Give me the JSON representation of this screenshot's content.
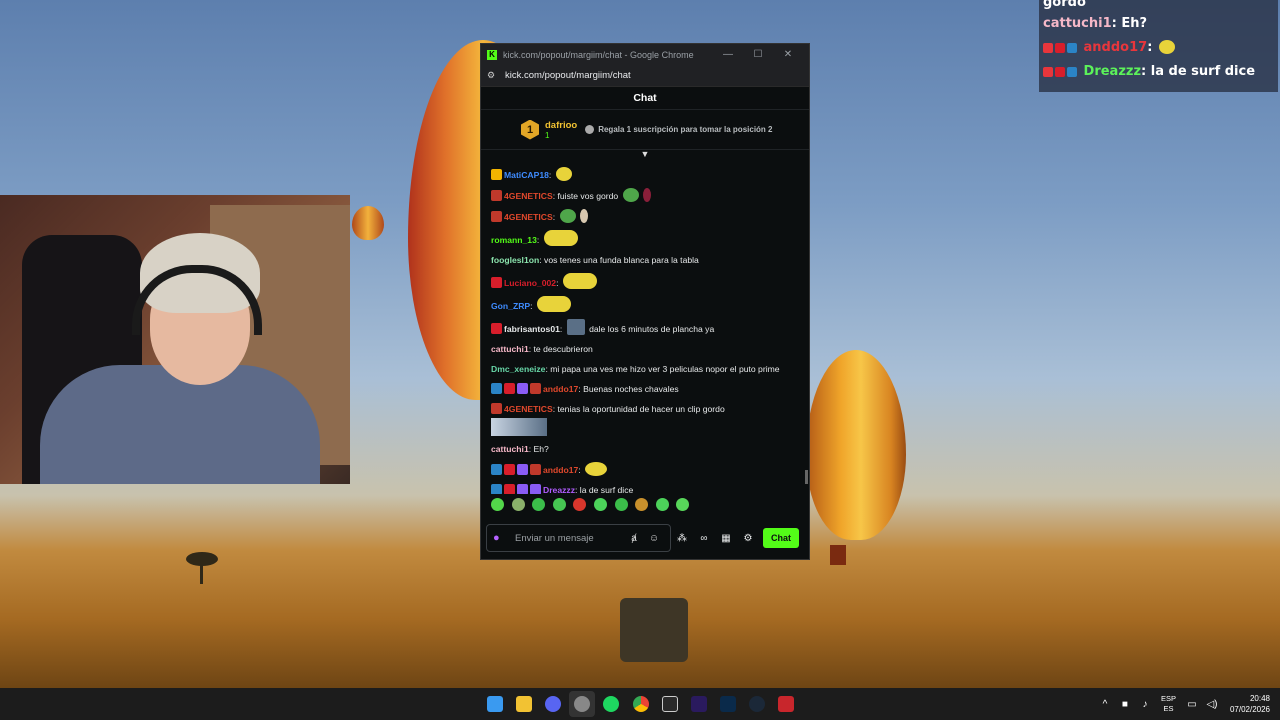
{
  "browser": {
    "title": "kick.com/popout/margiim/chat - Google Chrome",
    "url": "kick.com/popout/margiim/chat",
    "logo": "K",
    "minimize": "—",
    "maximize": "☐",
    "close": "✕"
  },
  "chat": {
    "header": "Chat",
    "leaderboard": {
      "rank": "1",
      "user": "dafrioo",
      "count": "1",
      "gift_note": "Regala 1 suscripción para tomar la posición 2"
    },
    "messages": [
      {
        "user": "MatiCAP18",
        "text": ""
      },
      {
        "user": "4GENETICS",
        "text": "fuiste vos gordo"
      },
      {
        "user": "4GENETICS",
        "text": ""
      },
      {
        "user": "romann_13",
        "text": ""
      },
      {
        "user": "fooglesl1on",
        "text": "vos tenes una funda blanca para la tabla"
      },
      {
        "user": "Luciano_002",
        "text": ""
      },
      {
        "user": "Gon_ZRP",
        "text": ""
      },
      {
        "user": "fabrisantos01",
        "text": "dale los 6 minutos de plancha ya"
      },
      {
        "user": "cattuchi1",
        "text": "te descubrieron"
      },
      {
        "user": "Dmc_xeneize",
        "text": "mi papa una ves me hizo ver 3 peliculas nopor el puto prime"
      },
      {
        "user": "anddo17",
        "text": "Buenas noches chavales"
      },
      {
        "user": "4GENETICS",
        "text": "tenias la oportunidad de hacer un clip gordo"
      },
      {
        "user": "cattuchi1",
        "text": "Eh?"
      },
      {
        "user": "anddo17",
        "text": ""
      },
      {
        "user": "Dreazzz",
        "text": "la de surf dice"
      }
    ],
    "input_placeholder": "Enviar un mensaje",
    "send_label": "Chat"
  },
  "overlay": {
    "lines": [
      {
        "user": "gordo",
        "text": ""
      },
      {
        "user": "cattuchi1",
        "text": "Eh?"
      },
      {
        "user": "anddo17",
        "text": ""
      },
      {
        "user": "Dreazzz",
        "text": "la de surf dice"
      }
    ]
  },
  "taskbar": {
    "lang_top": "ESP",
    "lang_bottom": "ES",
    "time": "20:48",
    "date": "07/02/2026"
  },
  "colors": {
    "kick_green": "#53fc18",
    "username_gold": "#f1c232"
  }
}
